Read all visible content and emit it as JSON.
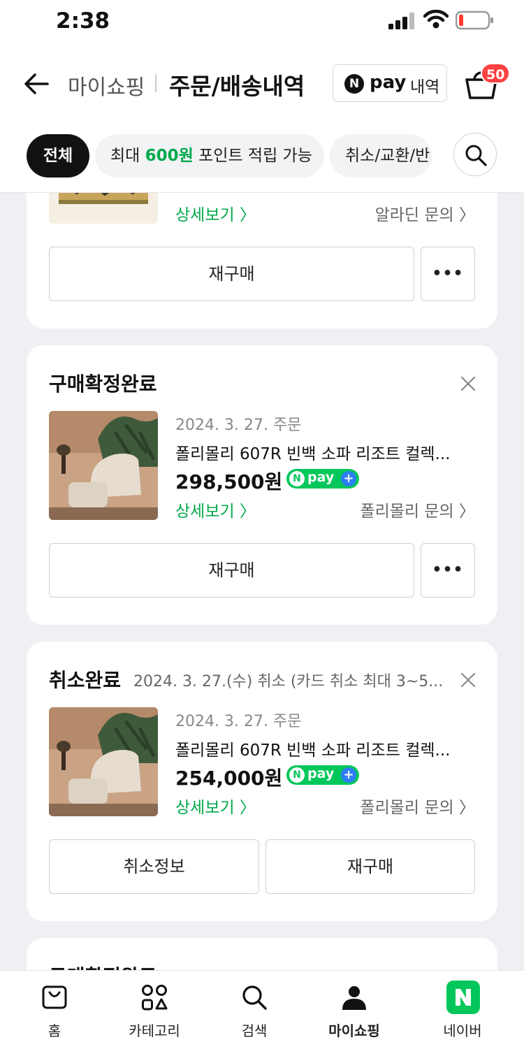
{
  "status": {
    "time": "2:38"
  },
  "header": {
    "crumb": "마이쇼핑",
    "title": "주문/배송내역",
    "npay": {
      "n": "N",
      "pay": "pay",
      "history": "내역"
    },
    "cart_badge": "50"
  },
  "filters": {
    "all": "전체",
    "points_prefix": "최대 ",
    "points_amount": "600원",
    "points_suffix": " 포인트 적립 가능",
    "cancel": "취소/교환/반"
  },
  "card1": {
    "detail": "상세보기 〉",
    "inquiry": "알라딘 문의 〉",
    "rebuy": "재구매",
    "more": "•••"
  },
  "card2": {
    "status": "구매확정완료",
    "order_date": "2024. 3. 27. 주문",
    "product": "폴리몰리 607R 빈백 소파 리조트 컬렉...",
    "price": "298,500원",
    "npay": {
      "n": "N",
      "pay": "pay",
      "plus": "+"
    },
    "detail": "상세보기 〉",
    "inquiry": "폴리몰리 문의 〉",
    "rebuy": "재구매",
    "more": "•••"
  },
  "card3": {
    "status": "취소완료",
    "cancel_note": "2024. 3. 27.(수) 취소 (카드 취소 최대 3~5...",
    "order_date": "2024. 3. 27. 주문",
    "product": "폴리몰리 607R 빈백 소파 리조트 컬렉...",
    "price": "254,000원",
    "npay": {
      "n": "N",
      "pay": "pay",
      "plus": "+"
    },
    "detail": "상세보기 〉",
    "inquiry": "폴리몰리 문의 〉",
    "cancel_info": "취소정보",
    "rebuy": "재구매"
  },
  "card4": {
    "status": "구매확정완료"
  },
  "tabbar": {
    "items": [
      {
        "label": "홈",
        "icon": "home-bag-icon"
      },
      {
        "label": "카테고리",
        "icon": "category-grid-icon"
      },
      {
        "label": "검색",
        "icon": "search-icon"
      },
      {
        "label": "마이쇼핑",
        "icon": "person-icon"
      },
      {
        "label": "네이버",
        "icon": "naver-logo-icon"
      }
    ]
  },
  "colors": {
    "accent": "#03c75a",
    "green_text": "#03a94d",
    "badge": "#ff4141"
  }
}
